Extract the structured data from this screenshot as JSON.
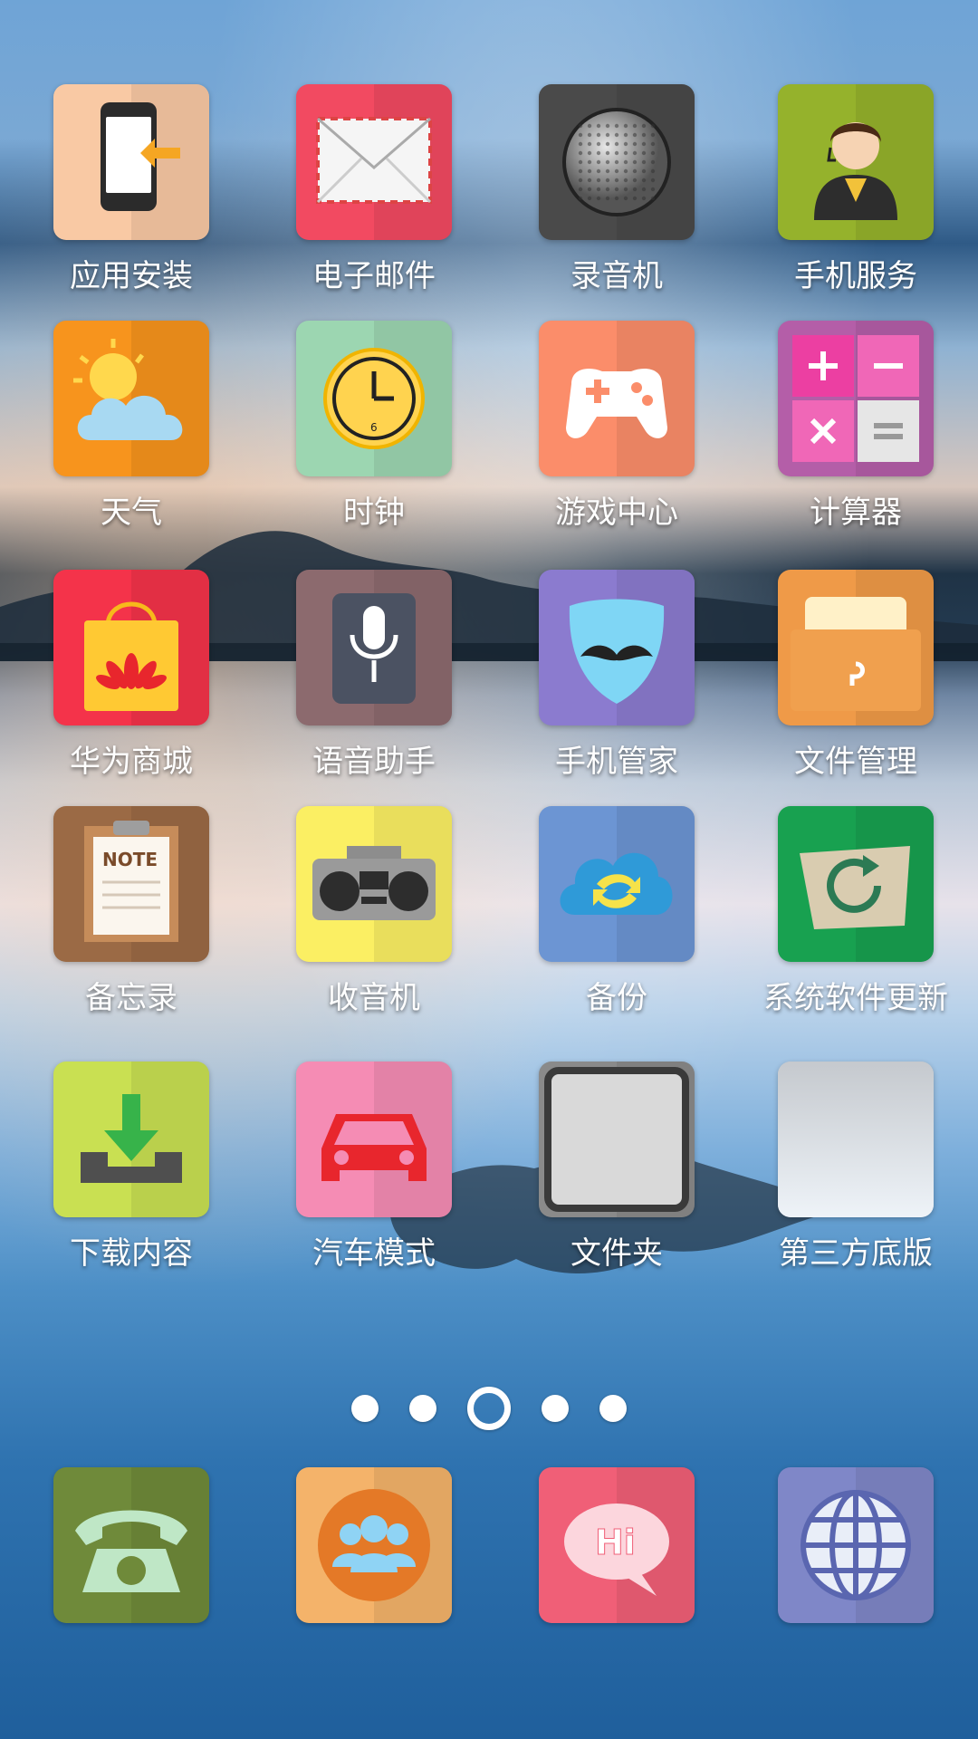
{
  "home_page": {
    "apps": [
      {
        "label": "应用安装",
        "icon": "phone-install-icon",
        "color": "#f9c9a4"
      },
      {
        "label": "电子邮件",
        "icon": "envelope-icon",
        "color": "#f24a61"
      },
      {
        "label": "录音机",
        "icon": "microphone-grille-icon",
        "color": "#4a4a4a"
      },
      {
        "label": "手机服务",
        "icon": "customer-service-icon",
        "color": "#95b22c"
      },
      {
        "label": "天气",
        "icon": "sun-cloud-icon",
        "color": "#f7941d"
      },
      {
        "label": "时钟",
        "icon": "clock-icon",
        "color": "#9cd6b1"
      },
      {
        "label": "游戏中心",
        "icon": "gamepad-icon",
        "color": "#fb8d6a"
      },
      {
        "label": "计算器",
        "icon": "calculator-icon",
        "color": "#b45ea8"
      },
      {
        "label": "华为商城",
        "icon": "shopping-bag-icon",
        "color": "#f4334a"
      },
      {
        "label": "语音助手",
        "icon": "voice-mic-icon",
        "color": "#8c6a6e"
      },
      {
        "label": "手机管家",
        "icon": "mustache-shield-icon",
        "color": "#8b7bcf"
      },
      {
        "label": "文件管理",
        "icon": "folder-icon",
        "color": "#ef9a48"
      },
      {
        "label": "备忘录",
        "icon": "note-clipboard-icon",
        "color": "#9b6a45"
      },
      {
        "label": "收音机",
        "icon": "boombox-icon",
        "color": "#fbef63"
      },
      {
        "label": "备份",
        "icon": "cloud-sync-icon",
        "color": "#6c95d3"
      },
      {
        "label": "系统软件更新",
        "icon": "update-refresh-icon",
        "color": "#18a150"
      },
      {
        "label": "下载内容",
        "icon": "download-tray-icon",
        "color": "#c9e052"
      },
      {
        "label": "汽车模式",
        "icon": "car-icon",
        "color": "#f58cb4"
      },
      {
        "label": "文件夹",
        "icon": "folder-empty-icon",
        "color": "#8a8a8a"
      },
      {
        "label": "第三方底版",
        "icon": "blank-tile-icon",
        "color": "#c8ced6"
      }
    ]
  },
  "page_indicator": {
    "count": 5,
    "active_index": 2
  },
  "dock": {
    "apps": [
      {
        "icon": "telephone-icon",
        "color": "#6f8a3a"
      },
      {
        "icon": "contacts-icon",
        "color": "#f4b36a"
      },
      {
        "icon": "messaging-hi-icon",
        "color": "#f05f77"
      },
      {
        "icon": "browser-globe-icon",
        "color": "#7f87c8"
      }
    ]
  }
}
